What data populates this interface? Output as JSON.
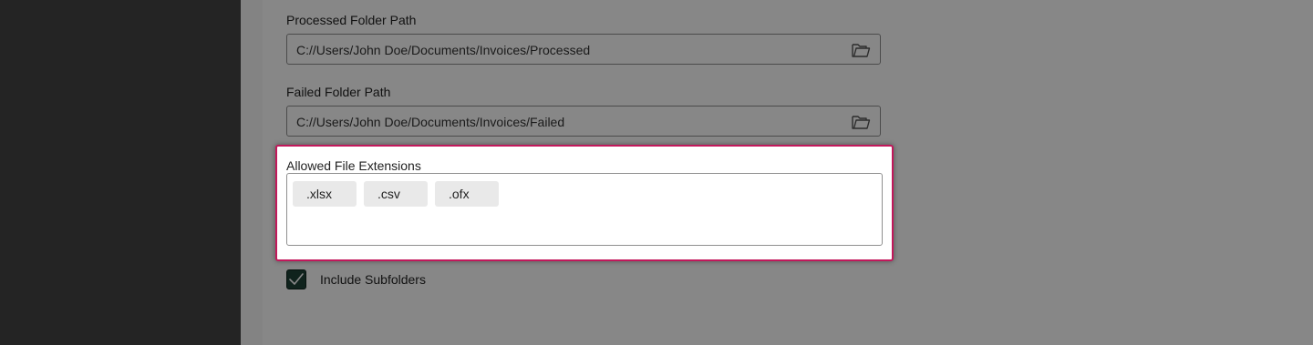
{
  "fields": {
    "processed": {
      "label": "Processed Folder Path",
      "value": "C://Users/John Doe/Documents/Invoices/Processed"
    },
    "failed": {
      "label": "Failed Folder Path",
      "value": "C://Users/John Doe/Documents/Invoices/Failed"
    }
  },
  "extensions": {
    "label": "Allowed File Extensions",
    "items": [
      ".xlsx",
      ".csv",
      ".ofx"
    ]
  },
  "include_subfolders": {
    "label": "Include Subfolders",
    "checked": true
  },
  "icons": {
    "folder": "folder-open-icon",
    "check": "checkmark-icon"
  },
  "colors": {
    "highlight_border": "#c2185b",
    "checkbox_fill": "#1f4237",
    "sidebar": "#444444"
  }
}
